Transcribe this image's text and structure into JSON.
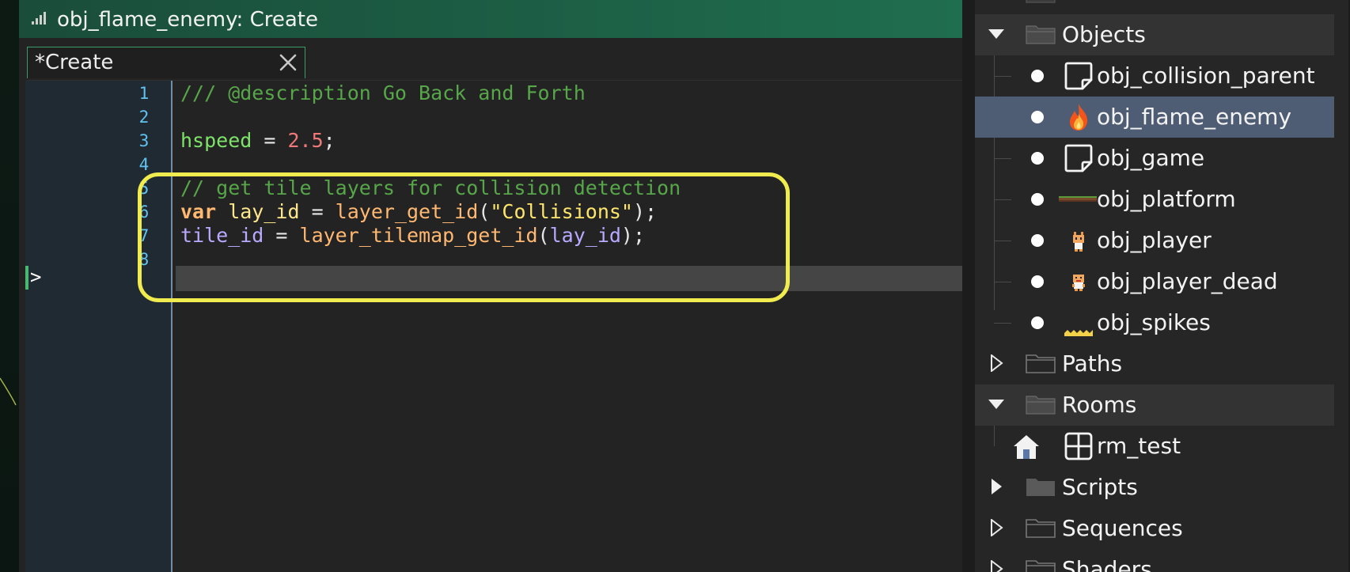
{
  "editor": {
    "title": "obj_flame_enemy: Create",
    "tab_label": "*Create",
    "line_numbers": [
      "1",
      "2",
      "3",
      "4",
      "5",
      "6",
      "7",
      "8"
    ],
    "code": {
      "l1_comment": "/// @description Go Back and Forth",
      "l3_var": "hspeed",
      "l3_eq": " = ",
      "l3_num": "2.5",
      "l3_semi": ";",
      "l5_comment": "// get tile layers for collision detection",
      "l6_kw": "var",
      "l6_local": " lay_id",
      "l6_eq": " = ",
      "l6_func": "layer_get_id",
      "l6_open": "(",
      "l6_str": "\"Collisions\"",
      "l6_close": ");",
      "l7_inst": "tile_id",
      "l7_eq": " = ",
      "l7_func": "layer_tilemap_get_id",
      "l7_open": "(",
      "l7_arg": "lay_id",
      "l7_close": ");"
    },
    "current_line": "8"
  },
  "asset_browser": {
    "groups": [
      {
        "name": "Objects",
        "expanded": true
      },
      {
        "name": "Paths",
        "expanded": false
      },
      {
        "name": "Rooms",
        "expanded": true
      },
      {
        "name": "Scripts",
        "expanded": false
      },
      {
        "name": "Sequences",
        "expanded": false
      },
      {
        "name": "Shaders",
        "expanded": false
      }
    ],
    "objects": [
      {
        "name": "obj_collision_parent",
        "icon": "object-default-icon"
      },
      {
        "name": "obj_flame_enemy",
        "icon": "flame-icon",
        "selected": true
      },
      {
        "name": "obj_game",
        "icon": "object-default-icon"
      },
      {
        "name": "obj_platform",
        "icon": "platform-sprite-icon"
      },
      {
        "name": "obj_player",
        "icon": "player-sprite-icon"
      },
      {
        "name": "obj_player_dead",
        "icon": "player-dead-sprite-icon"
      },
      {
        "name": "obj_spikes",
        "icon": "spikes-sprite-icon"
      }
    ],
    "rooms": [
      {
        "name": "rm_test",
        "icon": "room-icon",
        "home": true
      }
    ]
  },
  "colors": {
    "titlebar": "#1c5b43",
    "highlight_box": "#f0ec50",
    "selected_row": "#4f5d74",
    "line_number": "#62c2f0"
  }
}
